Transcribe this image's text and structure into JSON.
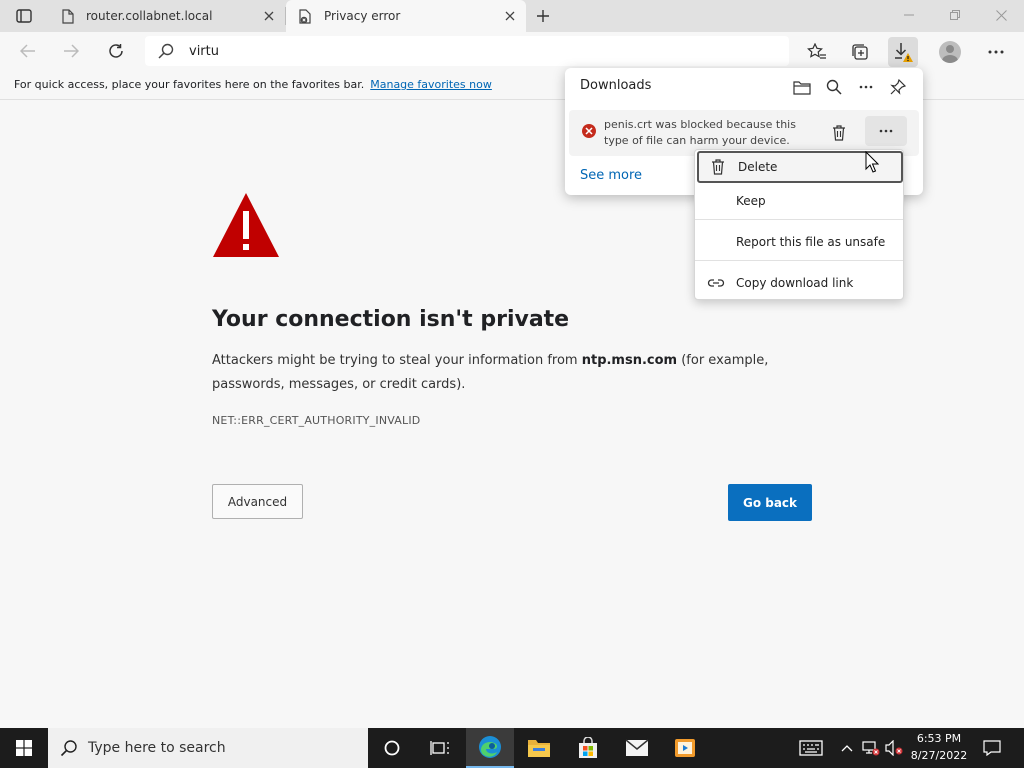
{
  "browser": {
    "tabs": [
      {
        "title": "router.collabnet.local"
      },
      {
        "title": "Privacy error"
      }
    ],
    "address_bar": {
      "value": "virtu"
    },
    "favorites_bar": {
      "message": "For quick access, place your favorites here on the favorites bar.",
      "link": "Manage favorites now"
    }
  },
  "page": {
    "heading": "Your connection isn't private",
    "description_prefix": "Attackers might be trying to steal your information from ",
    "domain": "ntp.msn.com",
    "description_suffix": " (for example, passwords, messages, or credit cards).",
    "error_code": "NET::ERR_CERT_AUTHORITY_INVALID",
    "advanced_label": "Advanced",
    "go_back_label": "Go back"
  },
  "downloads": {
    "title": "Downloads",
    "item_text": "penis.crt was blocked because this type of file can harm your device.",
    "see_more": "See more"
  },
  "context_menu": {
    "items": [
      {
        "label": "Delete"
      },
      {
        "label": "Keep"
      },
      {
        "label": "Report this file as unsafe"
      },
      {
        "label": "Copy download link"
      }
    ]
  },
  "taskbar": {
    "search_placeholder": "Type here to search",
    "time": "6:53 PM",
    "date": "8/27/2022"
  },
  "colors": {
    "accent": "#0a6fbf",
    "warning": "#c00000",
    "error_badge": "#c42b1c",
    "taskbar": "#1c1c1c"
  }
}
